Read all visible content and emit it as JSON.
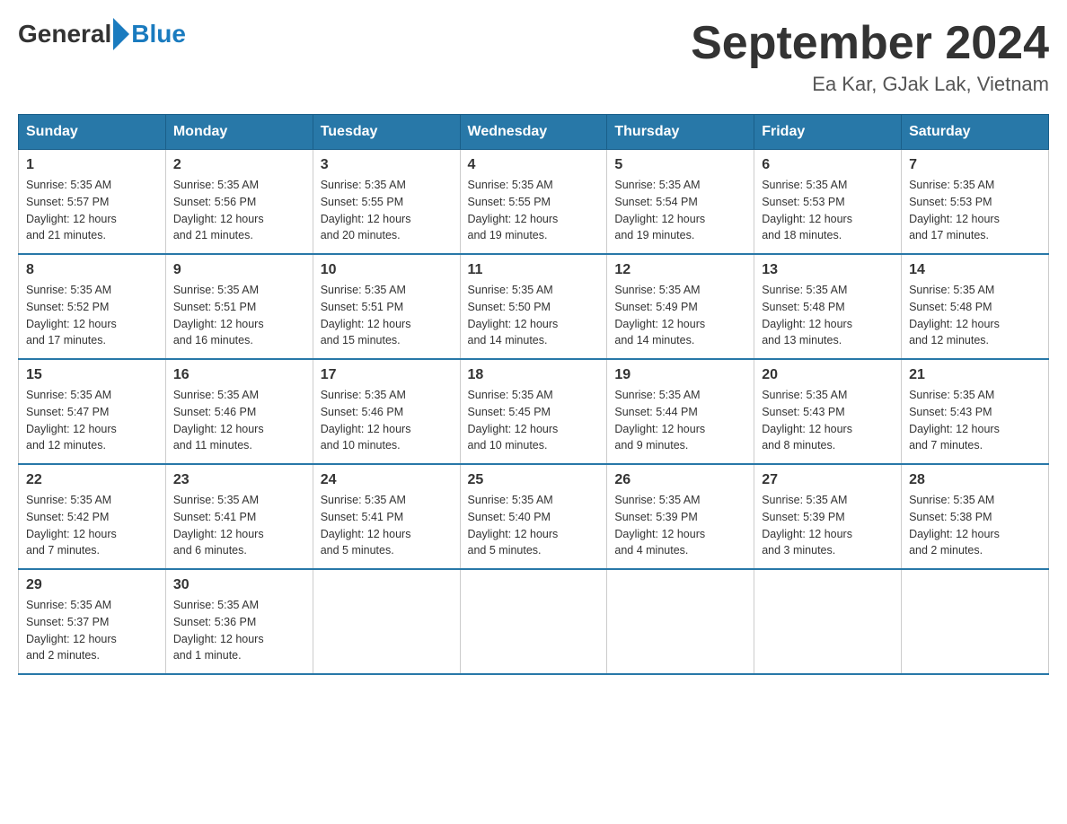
{
  "logo": {
    "general": "General",
    "blue": "Blue"
  },
  "title": "September 2024",
  "location": "Ea Kar, GJak Lak, Vietnam",
  "days_header": [
    "Sunday",
    "Monday",
    "Tuesday",
    "Wednesday",
    "Thursday",
    "Friday",
    "Saturday"
  ],
  "weeks": [
    [
      {
        "day": "1",
        "sunrise": "5:35 AM",
        "sunset": "5:57 PM",
        "daylight": "12 hours and 21 minutes."
      },
      {
        "day": "2",
        "sunrise": "5:35 AM",
        "sunset": "5:56 PM",
        "daylight": "12 hours and 21 minutes."
      },
      {
        "day": "3",
        "sunrise": "5:35 AM",
        "sunset": "5:55 PM",
        "daylight": "12 hours and 20 minutes."
      },
      {
        "day": "4",
        "sunrise": "5:35 AM",
        "sunset": "5:55 PM",
        "daylight": "12 hours and 19 minutes."
      },
      {
        "day": "5",
        "sunrise": "5:35 AM",
        "sunset": "5:54 PM",
        "daylight": "12 hours and 19 minutes."
      },
      {
        "day": "6",
        "sunrise": "5:35 AM",
        "sunset": "5:53 PM",
        "daylight": "12 hours and 18 minutes."
      },
      {
        "day": "7",
        "sunrise": "5:35 AM",
        "sunset": "5:53 PM",
        "daylight": "12 hours and 17 minutes."
      }
    ],
    [
      {
        "day": "8",
        "sunrise": "5:35 AM",
        "sunset": "5:52 PM",
        "daylight": "12 hours and 17 minutes."
      },
      {
        "day": "9",
        "sunrise": "5:35 AM",
        "sunset": "5:51 PM",
        "daylight": "12 hours and 16 minutes."
      },
      {
        "day": "10",
        "sunrise": "5:35 AM",
        "sunset": "5:51 PM",
        "daylight": "12 hours and 15 minutes."
      },
      {
        "day": "11",
        "sunrise": "5:35 AM",
        "sunset": "5:50 PM",
        "daylight": "12 hours and 14 minutes."
      },
      {
        "day": "12",
        "sunrise": "5:35 AM",
        "sunset": "5:49 PM",
        "daylight": "12 hours and 14 minutes."
      },
      {
        "day": "13",
        "sunrise": "5:35 AM",
        "sunset": "5:48 PM",
        "daylight": "12 hours and 13 minutes."
      },
      {
        "day": "14",
        "sunrise": "5:35 AM",
        "sunset": "5:48 PM",
        "daylight": "12 hours and 12 minutes."
      }
    ],
    [
      {
        "day": "15",
        "sunrise": "5:35 AM",
        "sunset": "5:47 PM",
        "daylight": "12 hours and 12 minutes."
      },
      {
        "day": "16",
        "sunrise": "5:35 AM",
        "sunset": "5:46 PM",
        "daylight": "12 hours and 11 minutes."
      },
      {
        "day": "17",
        "sunrise": "5:35 AM",
        "sunset": "5:46 PM",
        "daylight": "12 hours and 10 minutes."
      },
      {
        "day": "18",
        "sunrise": "5:35 AM",
        "sunset": "5:45 PM",
        "daylight": "12 hours and 10 minutes."
      },
      {
        "day": "19",
        "sunrise": "5:35 AM",
        "sunset": "5:44 PM",
        "daylight": "12 hours and 9 minutes."
      },
      {
        "day": "20",
        "sunrise": "5:35 AM",
        "sunset": "5:43 PM",
        "daylight": "12 hours and 8 minutes."
      },
      {
        "day": "21",
        "sunrise": "5:35 AM",
        "sunset": "5:43 PM",
        "daylight": "12 hours and 7 minutes."
      }
    ],
    [
      {
        "day": "22",
        "sunrise": "5:35 AM",
        "sunset": "5:42 PM",
        "daylight": "12 hours and 7 minutes."
      },
      {
        "day": "23",
        "sunrise": "5:35 AM",
        "sunset": "5:41 PM",
        "daylight": "12 hours and 6 minutes."
      },
      {
        "day": "24",
        "sunrise": "5:35 AM",
        "sunset": "5:41 PM",
        "daylight": "12 hours and 5 minutes."
      },
      {
        "day": "25",
        "sunrise": "5:35 AM",
        "sunset": "5:40 PM",
        "daylight": "12 hours and 5 minutes."
      },
      {
        "day": "26",
        "sunrise": "5:35 AM",
        "sunset": "5:39 PM",
        "daylight": "12 hours and 4 minutes."
      },
      {
        "day": "27",
        "sunrise": "5:35 AM",
        "sunset": "5:39 PM",
        "daylight": "12 hours and 3 minutes."
      },
      {
        "day": "28",
        "sunrise": "5:35 AM",
        "sunset": "5:38 PM",
        "daylight": "12 hours and 2 minutes."
      }
    ],
    [
      {
        "day": "29",
        "sunrise": "5:35 AM",
        "sunset": "5:37 PM",
        "daylight": "12 hours and 2 minutes."
      },
      {
        "day": "30",
        "sunrise": "5:35 AM",
        "sunset": "5:36 PM",
        "daylight": "12 hours and 1 minute."
      },
      null,
      null,
      null,
      null,
      null
    ]
  ],
  "labels": {
    "sunrise": "Sunrise:",
    "sunset": "Sunset:",
    "daylight": "Daylight:"
  }
}
